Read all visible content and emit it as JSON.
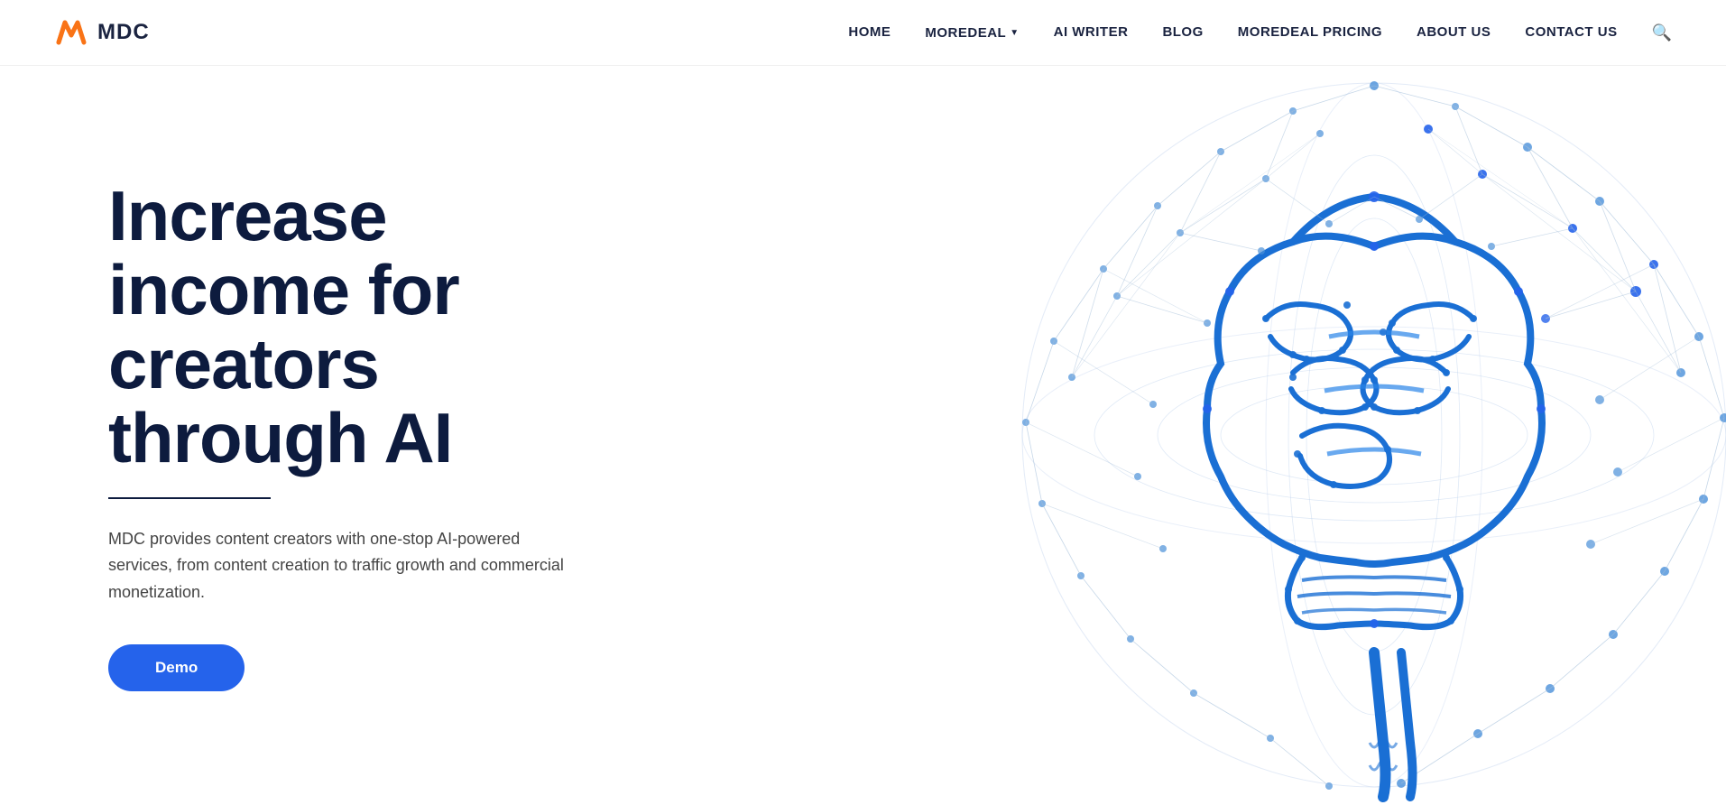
{
  "brand": {
    "logo_text": "MDC",
    "logo_icon_color": "#f97316"
  },
  "navbar": {
    "links": [
      {
        "id": "home",
        "label": "HOME",
        "has_dropdown": false
      },
      {
        "id": "moredeal",
        "label": "MOREDEAL",
        "has_dropdown": true
      },
      {
        "id": "ai-writer",
        "label": "AI WRITER",
        "has_dropdown": false
      },
      {
        "id": "blog",
        "label": "BLOG",
        "has_dropdown": false
      },
      {
        "id": "moredeal-pricing",
        "label": "MOREDEAL PRICING",
        "has_dropdown": false
      },
      {
        "id": "about-us",
        "label": "ABOUT US",
        "has_dropdown": false
      },
      {
        "id": "contact-us",
        "label": "CONTACT US",
        "has_dropdown": false
      }
    ]
  },
  "hero": {
    "title": "Increase income for creators through AI",
    "description": "MDC provides content creators with one-stop AI-powered services, from content creation to traffic growth and commercial monetization.",
    "cta_label": "Demo"
  }
}
